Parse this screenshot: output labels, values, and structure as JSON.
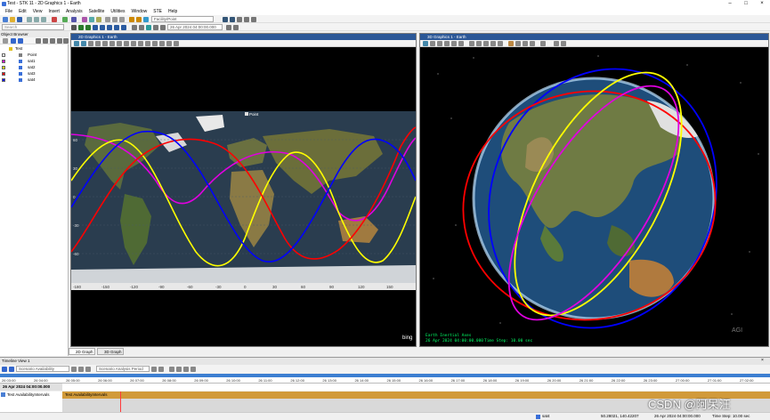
{
  "titlebar": {
    "title": "Test - STK 11 - 2D Graphics 1 - Earth"
  },
  "menu": [
    "File",
    "Edit",
    "View",
    "Insert",
    "Analysis",
    "Satellite",
    "Utilities",
    "Window",
    "STE",
    "Help"
  ],
  "toolbar": {
    "object_combo": "Facility/Point",
    "time_display": "26 Apr 2024 04:00:00.000"
  },
  "object_browser": {
    "title": "Object Browser",
    "search_placeholder": "Search",
    "items": [
      {
        "label": "Test",
        "color": "#e0c020"
      },
      {
        "label": "Point",
        "color": "#808080"
      },
      {
        "label": "sat1",
        "color": "#e000e0"
      },
      {
        "label": "sat2",
        "color": "#ffff00"
      },
      {
        "label": "sat3",
        "color": "#ff0000"
      },
      {
        "label": "sat4",
        "color": "#0000ff"
      }
    ]
  },
  "map2d": {
    "title": "2D Graphics 1 - Earth",
    "point_label": "Point",
    "lat_labels": [
      "60",
      "30",
      "0",
      "-30",
      "-60"
    ],
    "lon_labels": [
      "-180",
      "-150",
      "-120",
      "-90",
      "-60",
      "-30",
      "0",
      "30",
      "60",
      "90",
      "120",
      "150"
    ],
    "watermark": "bing"
  },
  "globe3d": {
    "title": "3D Graphics 1 - Earth",
    "frame_label": "Earth Inertial Axes",
    "time_label": "26 Apr 2024 04:00:00.000",
    "timestep_label": "Time Step: 10.00 sec",
    "logo": "AGI"
  },
  "tabs": [
    "2D Graph",
    "3D Graph"
  ],
  "timeline": {
    "title": "Timeline View 1",
    "combo1": "Scenario Availability",
    "combo2": "Scenario Analysis Period",
    "current_time": "26 Apr 2024 04:00:00.000",
    "row_label": "Test AvailabilityIntervals",
    "bar_label": "Test AvailabilityIntervals",
    "ticks": [
      "26 03:00",
      "26 04:00",
      "26 05:00",
      "26 06:00",
      "26 07:00",
      "26 08:00",
      "26 09:00",
      "26 10:00",
      "26 11:00",
      "26 12:00",
      "26 13:00",
      "26 14:00",
      "26 15:00",
      "26 16:00",
      "26 17:00",
      "26 18:00",
      "26 19:00",
      "26 20:00",
      "26 21:00",
      "26 22:00",
      "26 23:00",
      "27 00:00",
      "27 01:00",
      "27 02:00"
    ]
  },
  "status": {
    "object": "sat4",
    "coords": "50.28021, 140.42207",
    "time": "26 Apr 2024 04:00:00.000",
    "timestep": "Time Step: 10.00 sec"
  },
  "overlay": {
    "watermark": "CSDN @阿呆汪"
  }
}
